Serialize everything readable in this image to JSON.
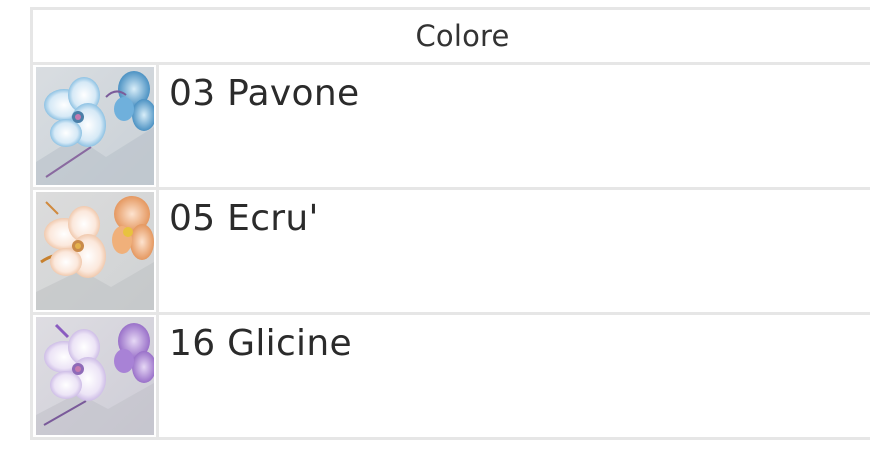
{
  "table": {
    "header": "Colore",
    "rows": [
      {
        "label": "03 Pavone",
        "swatch_icon": "blue-orchid-swatch",
        "accent": "#3f8fc4"
      },
      {
        "label": "05 Ecru'",
        "swatch_icon": "peach-orchid-swatch",
        "accent": "#e39a5c"
      },
      {
        "label": "16 Glicine",
        "swatch_icon": "lilac-orchid-swatch",
        "accent": "#9a6cc2"
      }
    ]
  }
}
